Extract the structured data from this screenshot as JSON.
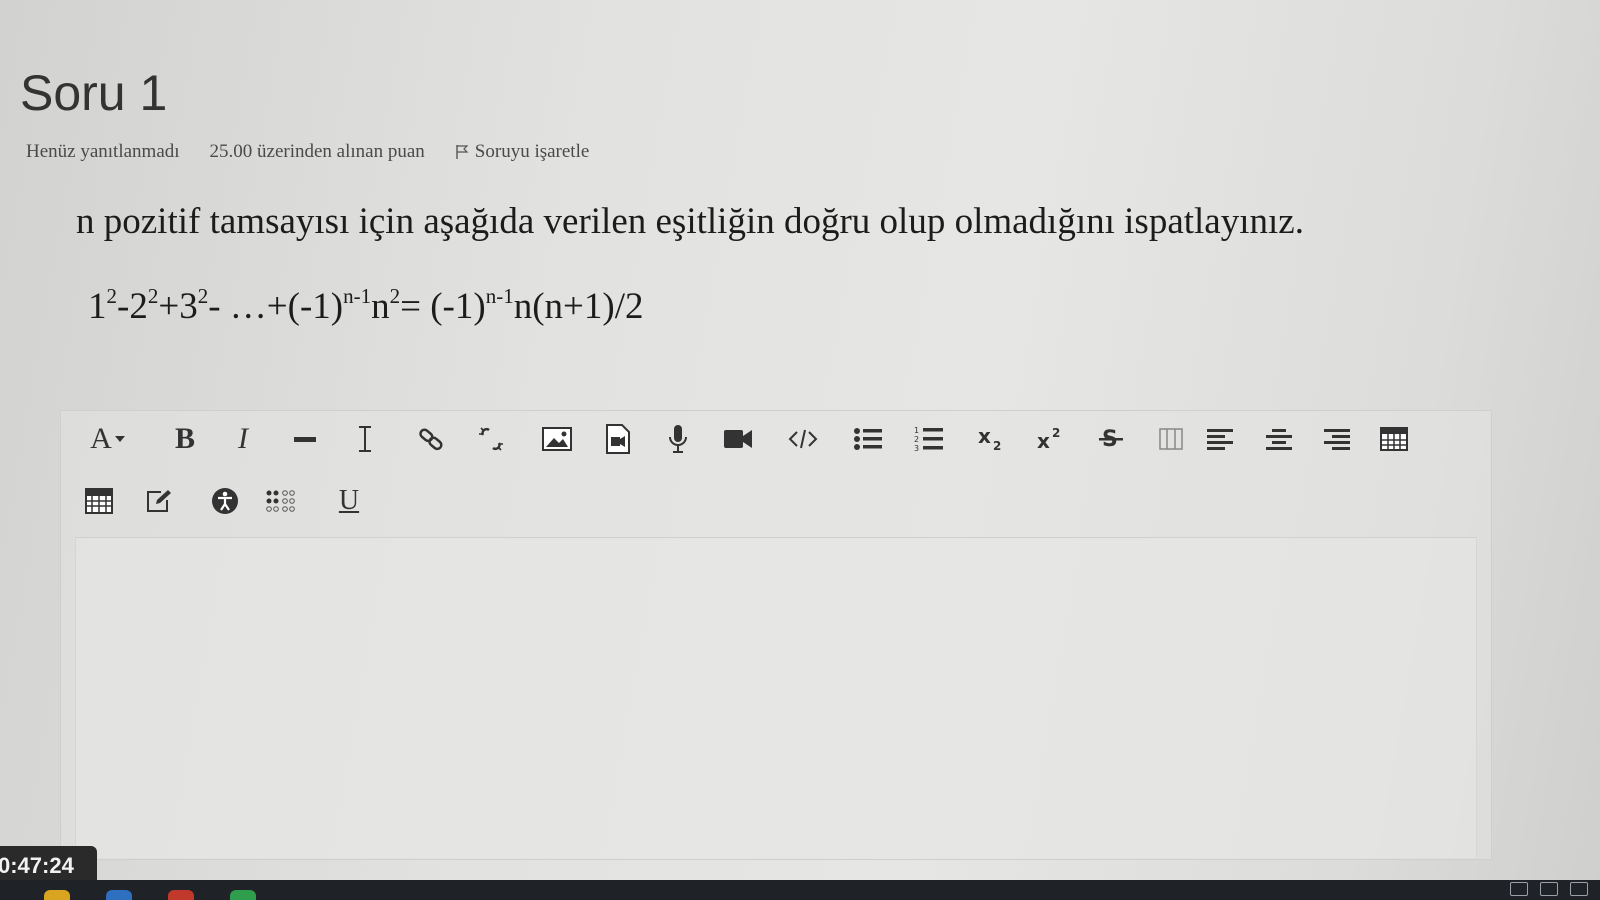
{
  "page": {
    "title": "Soru 1"
  },
  "question_meta": {
    "status": "Henüz yanıtlanmadı",
    "score": "25.00 üzerinden alınan puan",
    "flag_label": "Soruyu işaretle"
  },
  "question": {
    "text": "n pozitif tamsayısı için aşağıda verilen eşitliğin doğru olup olmadığını ispatlayınız.",
    "equation": {
      "p1": "1",
      "s1": "2",
      "p2": "-2",
      "s2": "2",
      "p3": "+3",
      "s3": "2",
      "p4": "- …+(-1)",
      "s4": "n-1",
      "p5": "n",
      "s5": "2",
      "p6": "= (-1)",
      "s6": "n-1",
      "p7": "n(n+1)/2"
    }
  },
  "toolbar": {
    "font_color_label": "A",
    "bold_label": "B",
    "italic_label": "I",
    "underline_label": "U",
    "icons": [
      "font-color-icon",
      "bold-icon",
      "italic-icon",
      "horizontal-rule-icon",
      "text-cursor-icon",
      "link-icon",
      "unlink-icon",
      "image-icon",
      "media-file-icon",
      "microphone-icon",
      "video-camera-icon",
      "code-icon",
      "bullet-list-icon",
      "numbered-list-icon",
      "subscript-icon",
      "superscript-icon",
      "strikethrough-icon",
      "columns-icon",
      "align-left-icon",
      "align-center-icon",
      "align-right-icon",
      "table-icon",
      "calculator-icon",
      "edit-icon",
      "accessibility-icon",
      "special-characters-icon",
      "underline-icon"
    ]
  },
  "timer": {
    "value": "0:47:24"
  },
  "colors": {
    "background": "#e2e2e0",
    "text": "#1c1c1c",
    "timer_bg": "#2a2a2a",
    "taskbar_bg": "#1f2226"
  }
}
